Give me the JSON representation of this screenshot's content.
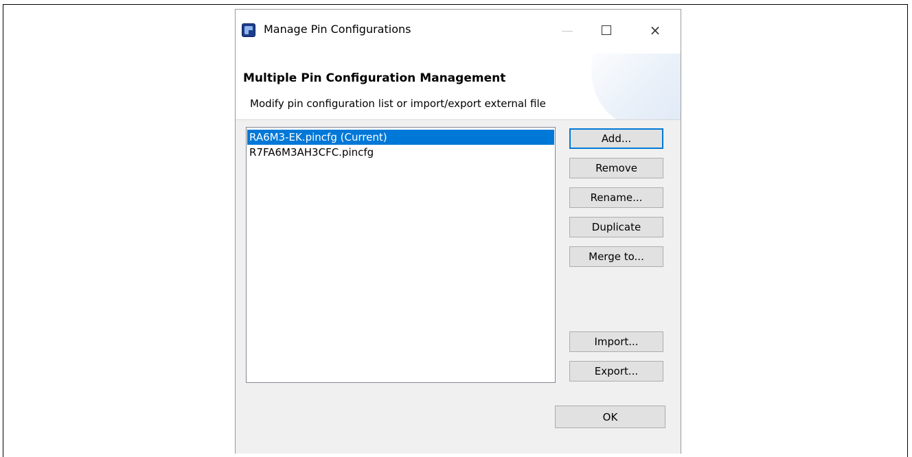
{
  "window": {
    "title": "Manage Pin Configurations",
    "icon": "pin-configurator-app-icon",
    "controls": {
      "minimize": "minimize-icon",
      "maximize": "maximize-icon",
      "close_glyph": "×"
    }
  },
  "header": {
    "title": "Multiple Pin Configuration Management",
    "description": "Modify pin configuration list or import/export external file"
  },
  "config_list": {
    "items": [
      {
        "label": "RA6M3-EK.pincfg (Current)",
        "selected": true
      },
      {
        "label": "R7FA6M3AH3CFC.pincfg",
        "selected": false
      }
    ]
  },
  "buttons": {
    "add": "Add...",
    "remove": "Remove",
    "rename": "Rename...",
    "duplicate": "Duplicate",
    "merge": "Merge to...",
    "import": "Import...",
    "export": "Export...",
    "ok": "OK"
  },
  "colors": {
    "selection": "#0078d7",
    "dialog_background": "#f0f0f0",
    "button_face": "#e1e1e1"
  }
}
